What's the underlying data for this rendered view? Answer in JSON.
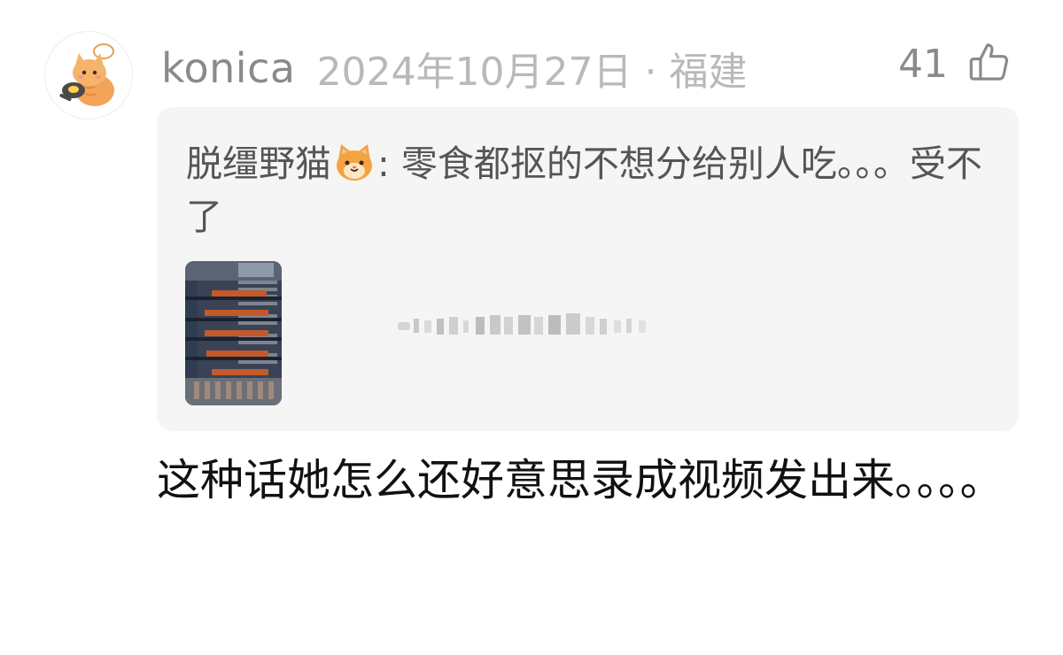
{
  "comment": {
    "username": "konica",
    "meta": "2024年10月27日 · 福建",
    "like_count": "41",
    "body": "这种话她怎么还好意思录成视频发出来。。。。"
  },
  "quoted": {
    "author": "脱缰野猫",
    "text_after_emoji": ": 零食都抠的不想分给别人吃。。。受不了",
    "emoji": "cat-face-emoji",
    "attachment": "video-thumbnail"
  },
  "icons": {
    "like": "thumbs-up-icon",
    "avatar": "cat-avatar-icon"
  },
  "colors": {
    "username": "#8a8a8a",
    "meta": "#b9b9b9",
    "quote_bg": "#f5f5f5",
    "quote_text": "#555555",
    "body_text": "#111111"
  }
}
